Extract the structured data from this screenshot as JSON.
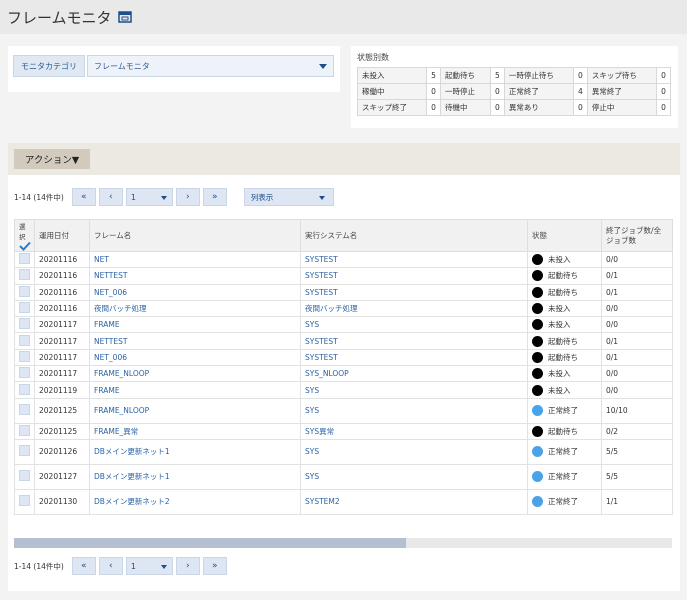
{
  "header": {
    "title": "フレームモニタ",
    "popout_icon": "popout-window-icon"
  },
  "category": {
    "label": "モニタカテゴリ",
    "selected": "フレームモニタ"
  },
  "status_summary": {
    "title": "状態別数",
    "rows": [
      [
        {
          "label": "未投入",
          "count": "5"
        },
        {
          "label": "起動待ち",
          "count": "5"
        },
        {
          "label": "一時停止待ち",
          "count": "0"
        },
        {
          "label": "スキップ待ち",
          "count": "0"
        }
      ],
      [
        {
          "label": "稼働中",
          "count": "0"
        },
        {
          "label": "一時停止",
          "count": "0"
        },
        {
          "label": "正常終了",
          "count": "4"
        },
        {
          "label": "異常終了",
          "count": "0"
        }
      ],
      [
        {
          "label": "スキップ終了",
          "count": "0"
        },
        {
          "label": "待機中",
          "count": "0"
        },
        {
          "label": "異常あり",
          "count": "0"
        },
        {
          "label": "停止中",
          "count": "0"
        }
      ]
    ]
  },
  "actions": {
    "label": "アクション▼"
  },
  "pager": {
    "count_text": "1-14 (14件中)",
    "first": "«",
    "prev": "‹",
    "page": "1",
    "next": "›",
    "last": "»",
    "column_display": "列表示"
  },
  "table": {
    "headers": {
      "select": "選択",
      "date": "運用日付",
      "frame": "フレーム名",
      "system": "実行システム名",
      "status": "状態",
      "jobs": "終了ジョブ数/全ジョブ数"
    },
    "rows": [
      {
        "date": "20201116",
        "frame": "NET",
        "system": "SYSTEST",
        "status": "未投入",
        "status_color": "#000000",
        "jobs": "0/0",
        "tall": false
      },
      {
        "date": "20201116",
        "frame": "NETTEST",
        "system": "SYSTEST",
        "status": "起動待ち",
        "status_color": "#000000",
        "jobs": "0/1",
        "tall": false
      },
      {
        "date": "20201116",
        "frame": "NET_006",
        "system": "SYSTEST",
        "status": "起動待ち",
        "status_color": "#000000",
        "jobs": "0/1",
        "tall": false
      },
      {
        "date": "20201116",
        "frame": "夜間バッチ処理",
        "system": "夜間バッチ処理",
        "status": "未投入",
        "status_color": "#000000",
        "jobs": "0/0",
        "tall": false
      },
      {
        "date": "20201117",
        "frame": "FRAME",
        "system": "SYS",
        "status": "未投入",
        "status_color": "#000000",
        "jobs": "0/0",
        "tall": false
      },
      {
        "date": "20201117",
        "frame": "NETTEST",
        "system": "SYSTEST",
        "status": "起動待ち",
        "status_color": "#000000",
        "jobs": "0/1",
        "tall": false
      },
      {
        "date": "20201117",
        "frame": "NET_006",
        "system": "SYSTEST",
        "status": "起動待ち",
        "status_color": "#000000",
        "jobs": "0/1",
        "tall": false
      },
      {
        "date": "20201117",
        "frame": "FRAME_NLOOP",
        "system": "SYS_NLOOP",
        "status": "未投入",
        "status_color": "#000000",
        "jobs": "0/0",
        "tall": false
      },
      {
        "date": "20201119",
        "frame": "FRAME",
        "system": "SYS",
        "status": "未投入",
        "status_color": "#000000",
        "jobs": "0/0",
        "tall": false
      },
      {
        "date": "20201125",
        "frame": "FRAME_NLOOP",
        "system": "SYS",
        "status": "正常終了",
        "status_color": "#4aa3e8",
        "jobs": "10/10",
        "tall": true
      },
      {
        "date": "20201125",
        "frame": "FRAME_異常",
        "system": "SYS異常",
        "status": "起動待ち",
        "status_color": "#000000",
        "jobs": "0/2",
        "tall": false
      },
      {
        "date": "20201126",
        "frame": "DBメイン更新ネット1",
        "system": "SYS",
        "status": "正常終了",
        "status_color": "#4aa3e8",
        "jobs": "5/5",
        "tall": true
      },
      {
        "date": "20201127",
        "frame": "DBメイン更新ネット1",
        "system": "SYS",
        "status": "正常終了",
        "status_color": "#4aa3e8",
        "jobs": "5/5",
        "tall": true
      },
      {
        "date": "20201130",
        "frame": "DBメイン更新ネット2",
        "system": "SYSTEM2",
        "status": "正常終了",
        "status_color": "#4aa3e8",
        "jobs": "1/1",
        "tall": true
      }
    ]
  }
}
